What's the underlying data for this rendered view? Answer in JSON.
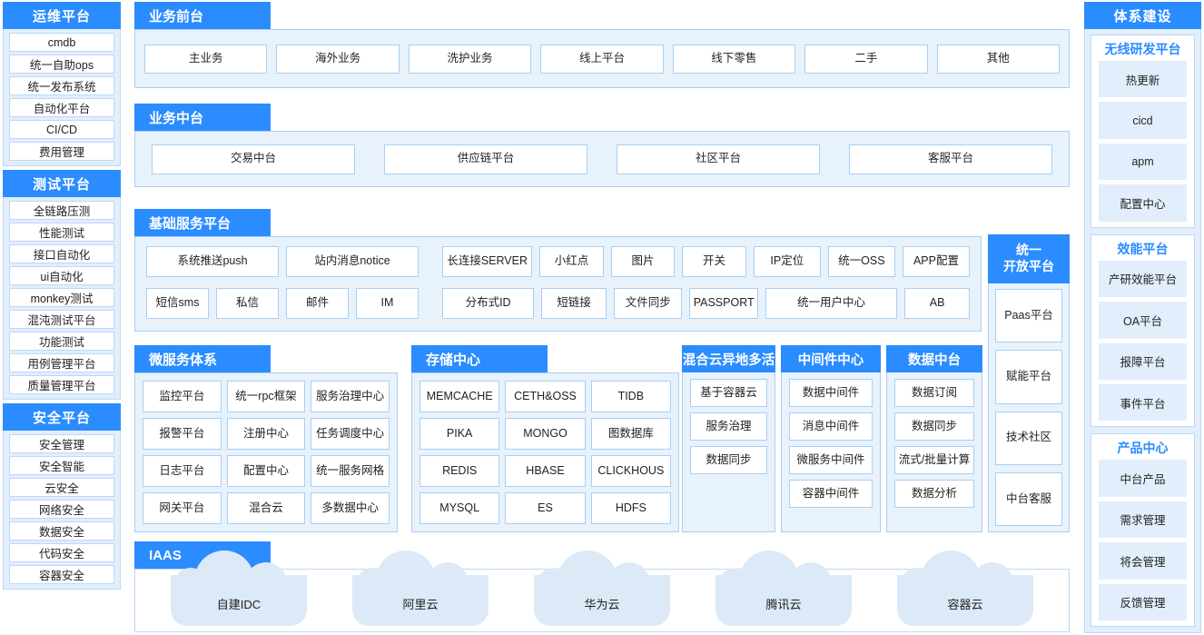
{
  "colors": {
    "accent": "#2a8cff",
    "panel_bg": "#e8f2fb",
    "panel_border": "#a8cff5",
    "rail_bg": "#e2eefb",
    "cloud": "#dce9f7"
  },
  "left_rail": {
    "groups": [
      {
        "title": "运维平台",
        "items": [
          "cmdb",
          "统一自助ops",
          "统一发布系统",
          "自动化平台",
          "CI/CD",
          "费用管理"
        ]
      },
      {
        "title": "测试平台",
        "items": [
          "全链路压测",
          "性能测试",
          "接口自动化",
          "ui自动化",
          "monkey测试",
          "混沌测试平台",
          "功能测试",
          "用例管理平台",
          "质量管理平台"
        ]
      },
      {
        "title": "安全平台",
        "items": [
          "安全管理",
          "安全智能",
          "云安全",
          "网络安全",
          "数据安全",
          "代码安全",
          "容器安全"
        ]
      }
    ]
  },
  "right_rail": {
    "title": "体系建设",
    "cards": [
      {
        "title": "无线研发平台",
        "items": [
          "热更新",
          "cicd",
          "apm",
          "配置中心"
        ]
      },
      {
        "title": "效能平台",
        "items": [
          "产研效能平台",
          "OA平台",
          "报障平台",
          "事件平台"
        ]
      },
      {
        "title": "产品中心",
        "items": [
          "中台产品",
          "需求管理",
          "将会管理",
          "反馈管理"
        ]
      }
    ]
  },
  "business_front": {
    "title": "业务前台",
    "items": [
      "主业务",
      "海外业务",
      "洗护业务",
      "线上平台",
      "线下零售",
      "二手",
      "其他"
    ]
  },
  "business_mid": {
    "title": "业务中台",
    "items": [
      "交易中台",
      "供应链平台",
      "社区平台",
      "客服平台"
    ]
  },
  "base_service": {
    "title": "基础服务平台",
    "left_group": {
      "row1": [
        "系统推送push",
        "站内消息notice"
      ],
      "row2": [
        "短信sms",
        "私信",
        "邮件",
        "IM"
      ]
    },
    "right_group": {
      "row1": [
        "长连接SERVER",
        "小红点",
        "图片",
        "开关",
        "IP定位",
        "统一OSS",
        "APP配置"
      ],
      "row2": [
        "分布式ID",
        "短链接",
        "文件同步",
        "PASSPORT",
        "统一用户中心",
        "AB"
      ]
    }
  },
  "open_platform": {
    "title_line1": "统一",
    "title_line2": "开放平台",
    "items": [
      "Paas平台",
      "赋能平台",
      "技术社区",
      "中台客服"
    ]
  },
  "microservice": {
    "title": "微服务体系",
    "items": [
      "监控平台",
      "统一rpc框架",
      "服务治理中心",
      "报警平台",
      "注册中心",
      "任务调度中心",
      "日志平台",
      "配置中心",
      "统一服务网格",
      "网关平台",
      "混合云",
      "多数据中心"
    ]
  },
  "storage": {
    "title": "存储中心",
    "items": [
      "MEMCACHE",
      "CETH&OSS",
      "TIDB",
      "PIKA",
      "MONGO",
      "图数据库",
      "REDIS",
      "HBASE",
      "CLICKHOUS",
      "MYSQL",
      "ES",
      "HDFS"
    ]
  },
  "hybrid_cloud": {
    "title": "混合云异地多活",
    "items": [
      "基于容器云",
      "服务治理",
      "数据同步"
    ]
  },
  "middleware": {
    "title": "中间件中心",
    "items": [
      "数据中间件",
      "消息中间件",
      "微服务中间件",
      "容器中间件"
    ]
  },
  "data_platform": {
    "title": "数据中台",
    "items": [
      "数据订阅",
      "数据同步",
      "流式/批量计算",
      "数据分析"
    ]
  },
  "iaas": {
    "title": "IAAS",
    "clouds": [
      "自建IDC",
      "阿里云",
      "华为云",
      "腾讯云",
      "容器云"
    ]
  }
}
